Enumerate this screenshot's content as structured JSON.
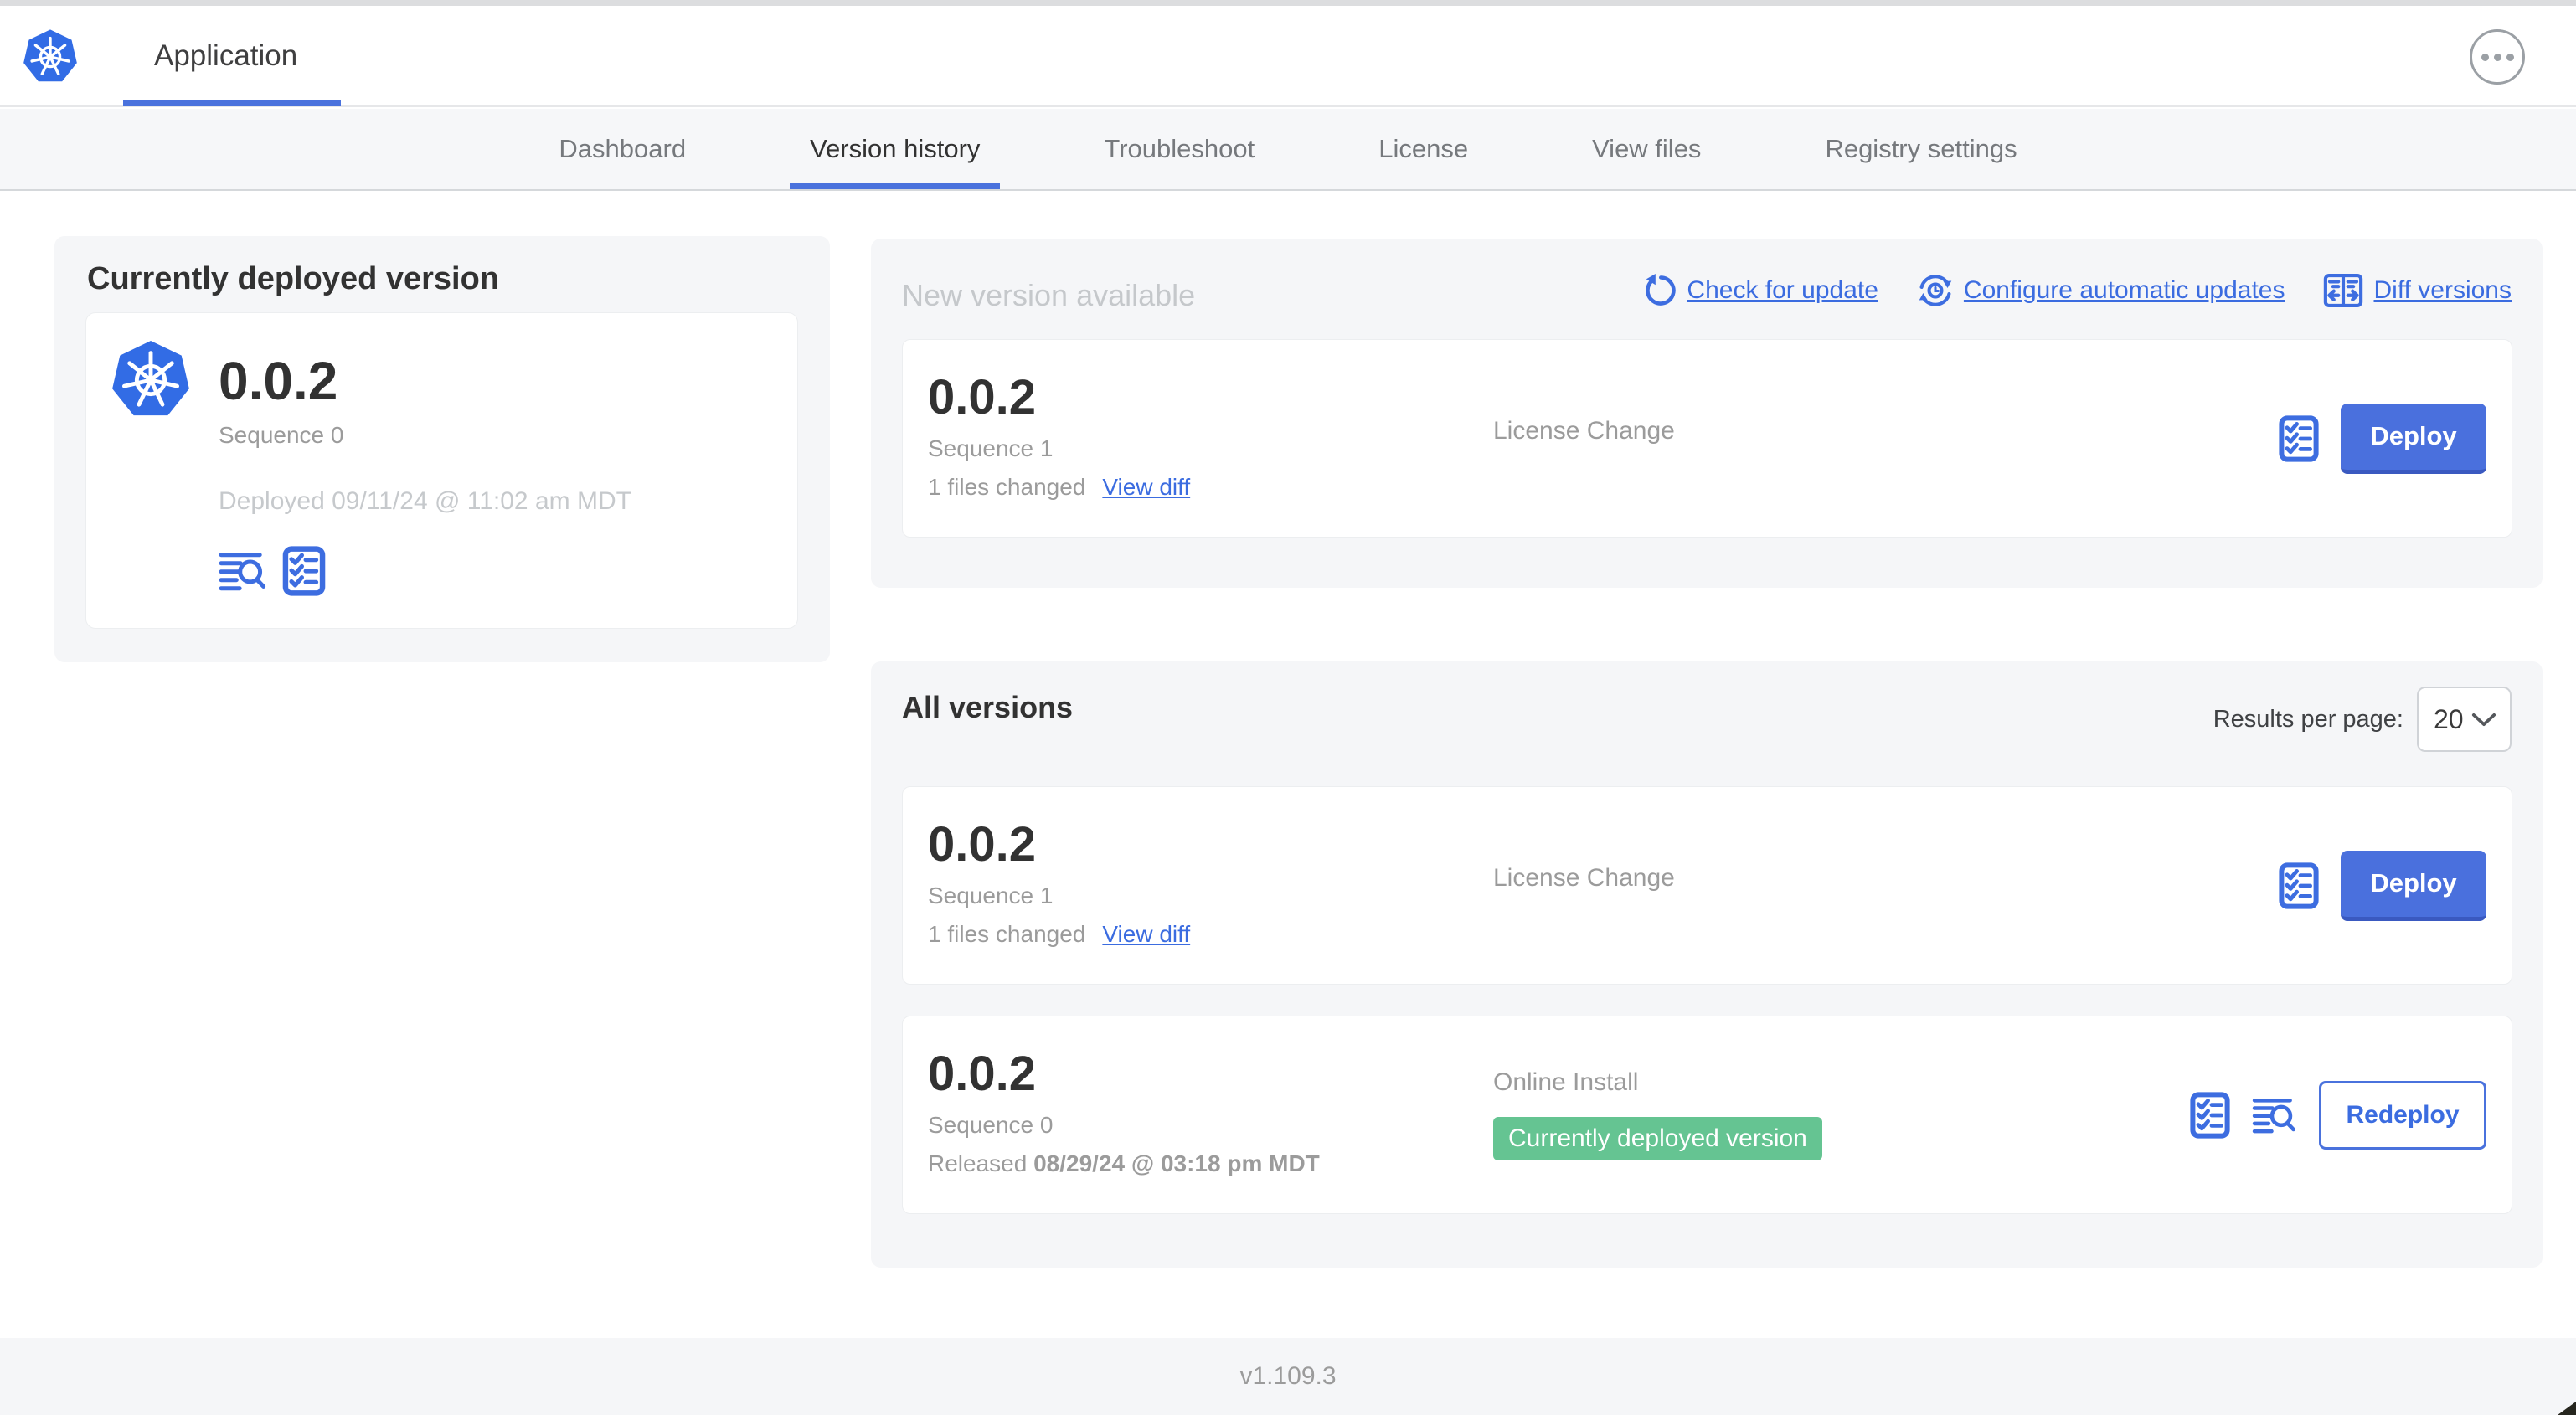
{
  "header": {
    "app_tab_label": "Application"
  },
  "nav": {
    "tabs": [
      {
        "label": "Dashboard"
      },
      {
        "label": "Version history"
      },
      {
        "label": "Troubleshoot"
      },
      {
        "label": "License"
      },
      {
        "label": "View files"
      },
      {
        "label": "Registry settings"
      }
    ],
    "active_tab": "Version history"
  },
  "current_version": {
    "title": "Currently deployed version",
    "version": "0.0.2",
    "sequence": "Sequence 0",
    "deployed": "Deployed 09/11/24 @ 11:02 am MDT"
  },
  "new_version": {
    "title": "New version available",
    "links": [
      {
        "label": "Check for update",
        "icon": "refresh-icon"
      },
      {
        "label": "Configure automatic updates",
        "icon": "auto-update-icon"
      },
      {
        "label": "Diff versions",
        "icon": "diff-icon"
      }
    ],
    "row": {
      "version": "0.0.2",
      "sequence": "Sequence 1",
      "files_changed": "1 files changed",
      "view_diff_label": "View diff",
      "source": "License Change",
      "action_label": "Deploy"
    }
  },
  "all_versions": {
    "title": "All versions",
    "results_per_page_label": "Results per page:",
    "results_per_page_value": "20",
    "rows": [
      {
        "version": "0.0.2",
        "sequence": "Sequence 1",
        "files_changed": "1 files changed",
        "view_diff_label": "View diff",
        "source": "License Change",
        "action_label": "Deploy"
      },
      {
        "version": "0.0.2",
        "sequence": "Sequence 0",
        "released_prefix": "Released ",
        "released_date": "08/29/24 @ 03:18 pm MDT",
        "source": "Online Install",
        "badge": "Currently deployed version",
        "action_label": "Redeploy"
      }
    ]
  },
  "footer": {
    "app_version": "v1.109.3"
  },
  "icons": [
    {
      "name": "kubernetes-logo",
      "shape": "blue heptagon with white helm wheel"
    },
    {
      "name": "logs-icon",
      "glyph": "lines + magnifier"
    },
    {
      "name": "checklist-icon",
      "glyph": "bordered list with checkmarks"
    },
    {
      "name": "refresh-icon",
      "glyph": "circular arrow"
    },
    {
      "name": "auto-update-icon",
      "glyph": "circular arrows with clock"
    },
    {
      "name": "diff-icon",
      "glyph": "split panes with arrows"
    },
    {
      "name": "ellipsis-icon",
      "glyph": "circled three dots"
    },
    {
      "name": "chevron-down-icon",
      "glyph": "v"
    }
  ],
  "colors": {
    "accent_blue": "#3b6ce0",
    "button_blue": "#4a70dd",
    "kubernetes_blue": "#326ce5",
    "badge_green": "#65c492",
    "text_dark": "#323232",
    "text_gray": "#9b9b9b",
    "text_light_gray": "#c6c9cc",
    "panel_bg": "#f5f6f8"
  }
}
